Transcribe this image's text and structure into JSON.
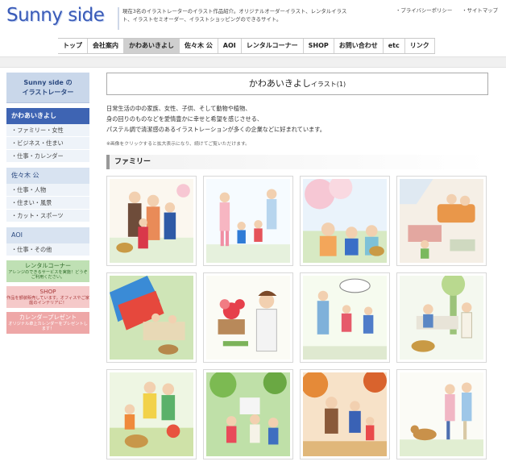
{
  "header": {
    "logo": "Sunny side",
    "description": "現在3名のイラストレーターのイラスト作品紹介。オリジナルオーダーイラスト、レンタルイラスト、イラストセミオーダー、イラストショッピングのできるサイト。",
    "links": [
      "・プライバシーポリシー",
      "・サイトマップ"
    ]
  },
  "nav": [
    "トップ",
    "会社案内",
    "かわあいきよし",
    "佐々木 公",
    "AOI",
    "レンタルコーナー",
    "SHOP",
    "お問い合わせ",
    "etc",
    "リンク"
  ],
  "sidebar": {
    "heading": [
      "Sunny side の",
      "イラストレーター"
    ],
    "sections": [
      {
        "title": "かわあいきよし",
        "items": [
          "・ファミリー・女性",
          "・ビジネス・住まい",
          "・仕事・カレンダー"
        ]
      },
      {
        "title": "佐々木 公",
        "items": [
          "・仕事・人物",
          "・住まい・風景",
          "・カット・スポーツ"
        ]
      },
      {
        "title": "AOI",
        "items": [
          "・仕事・その他"
        ]
      }
    ],
    "boxes": [
      {
        "title": "レンタルコーナー",
        "sub": "アレンジのできるサービスを実施！どうぞご利用ください。"
      },
      {
        "title": "SHOP",
        "sub": "作品を額装販売しています。オフィスやご家庭のインテリアに！"
      },
      {
        "title": "カレンダープレゼント",
        "sub": "オリジナル卓上カレンダーをプレゼントします！"
      }
    ]
  },
  "main": {
    "title": "かわあいきよし",
    "title_suffix": "イラスト(1)",
    "intro": [
      "日常生活の中の家族、女性、子供、そして動物や植物、",
      "身の回りのものなどを愛情豊かに幸せと希望を感じさせる、",
      "パステル調で清潔感のあるイラストレーションが多くの企業などに好まれています。"
    ],
    "note": "※画像をクリックすると拡大表示になり、続けてご覧いただけます。",
    "section": "ファミリー"
  },
  "colors": {
    "accent": "#3e64b3",
    "sidebar_bg": "#c9d7ea",
    "rental": "#bfe0b4",
    "shop": "#f5c9c9",
    "calendar": "#eea7a7"
  }
}
